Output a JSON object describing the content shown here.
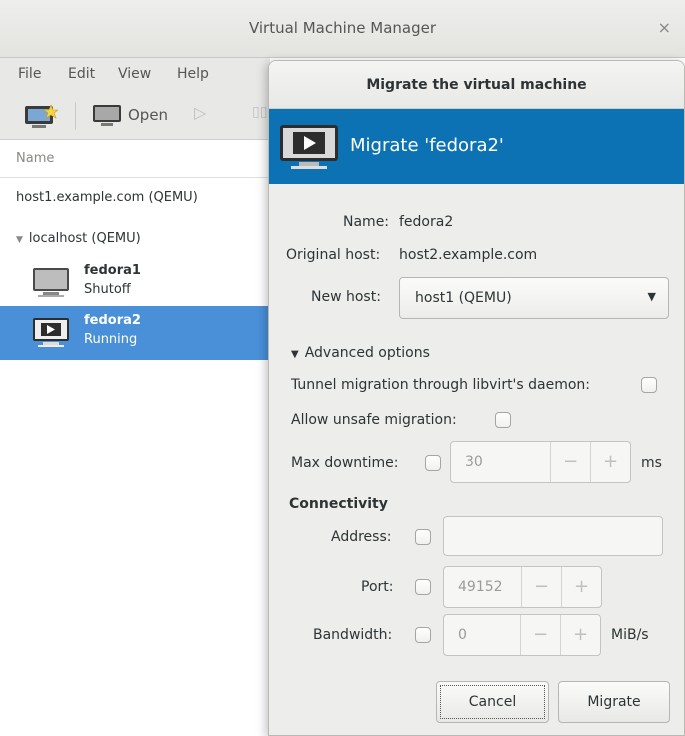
{
  "window": {
    "title": "Virtual Machine Manager",
    "close": "×"
  },
  "menu": [
    "File",
    "Edit",
    "View",
    "Help"
  ],
  "toolbar": {
    "open_label": "Open"
  },
  "list": {
    "header": "Name",
    "connections": [
      {
        "label": "host1.example.com (QEMU)"
      },
      {
        "label": "localhost (QEMU)"
      }
    ],
    "vms": [
      {
        "name": "fedora1",
        "state": "Shutoff"
      },
      {
        "name": "fedora2",
        "state": "Running"
      }
    ]
  },
  "dialog": {
    "title": "Migrate the virtual machine",
    "header": "Migrate 'fedora2'",
    "name_label": "Name:",
    "name_value": "fedora2",
    "orig_host_label": "Original host:",
    "orig_host_value": "host2.example.com",
    "new_host_label": "New host:",
    "new_host_value": "host1 (QEMU)",
    "advanced_label": "Advanced options",
    "tunnel_label": "Tunnel migration through libvirt's daemon:",
    "unsafe_label": "Allow unsafe migration:",
    "downtime_label": "Max downtime:",
    "downtime_value": "30",
    "downtime_unit": "ms",
    "connectivity_label": "Connectivity",
    "address_label": "Address:",
    "address_value": "",
    "port_label": "Port:",
    "port_value": "49152",
    "bandwidth_label": "Bandwidth:",
    "bandwidth_value": "0",
    "bandwidth_unit": "MiB/s",
    "spin_minus": "−",
    "spin_plus": "+",
    "cancel_label": "Cancel",
    "migrate_label": "Migrate"
  },
  "colors": {
    "accent": "#0c72b3",
    "selection": "#4a90d9"
  }
}
